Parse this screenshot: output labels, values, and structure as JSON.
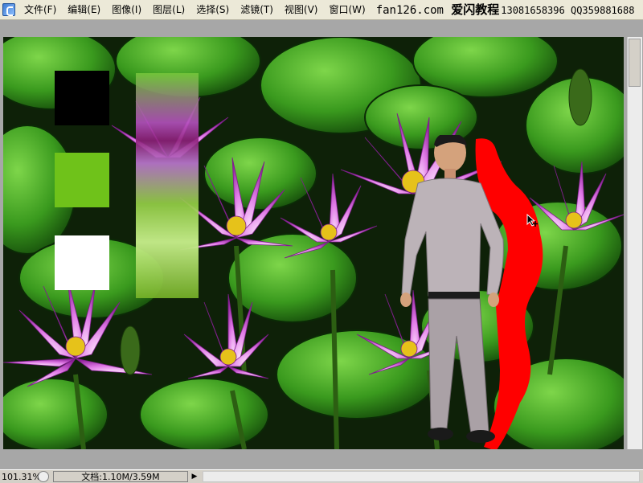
{
  "menubar": {
    "items": [
      {
        "label": "文件(F)"
      },
      {
        "label": "编辑(E)"
      },
      {
        "label": "图像(I)"
      },
      {
        "label": "图层(L)"
      },
      {
        "label": "选择(S)"
      },
      {
        "label": "滤镜(T)"
      },
      {
        "label": "视图(V)"
      },
      {
        "label": "窗口(W)"
      }
    ],
    "banner": {
      "site": "fan126.com",
      "name": "爱闪教程",
      "phone": "13081658396",
      "qq": "QQ359881688"
    }
  },
  "status": {
    "zoom": "101.31%",
    "doc_info": "文档:1.10M/3.59M"
  },
  "colors": {
    "swatch_black": "#000000",
    "swatch_green": "#6fc21a",
    "swatch_white": "#ffffff",
    "red_shape": "#ff0000"
  }
}
